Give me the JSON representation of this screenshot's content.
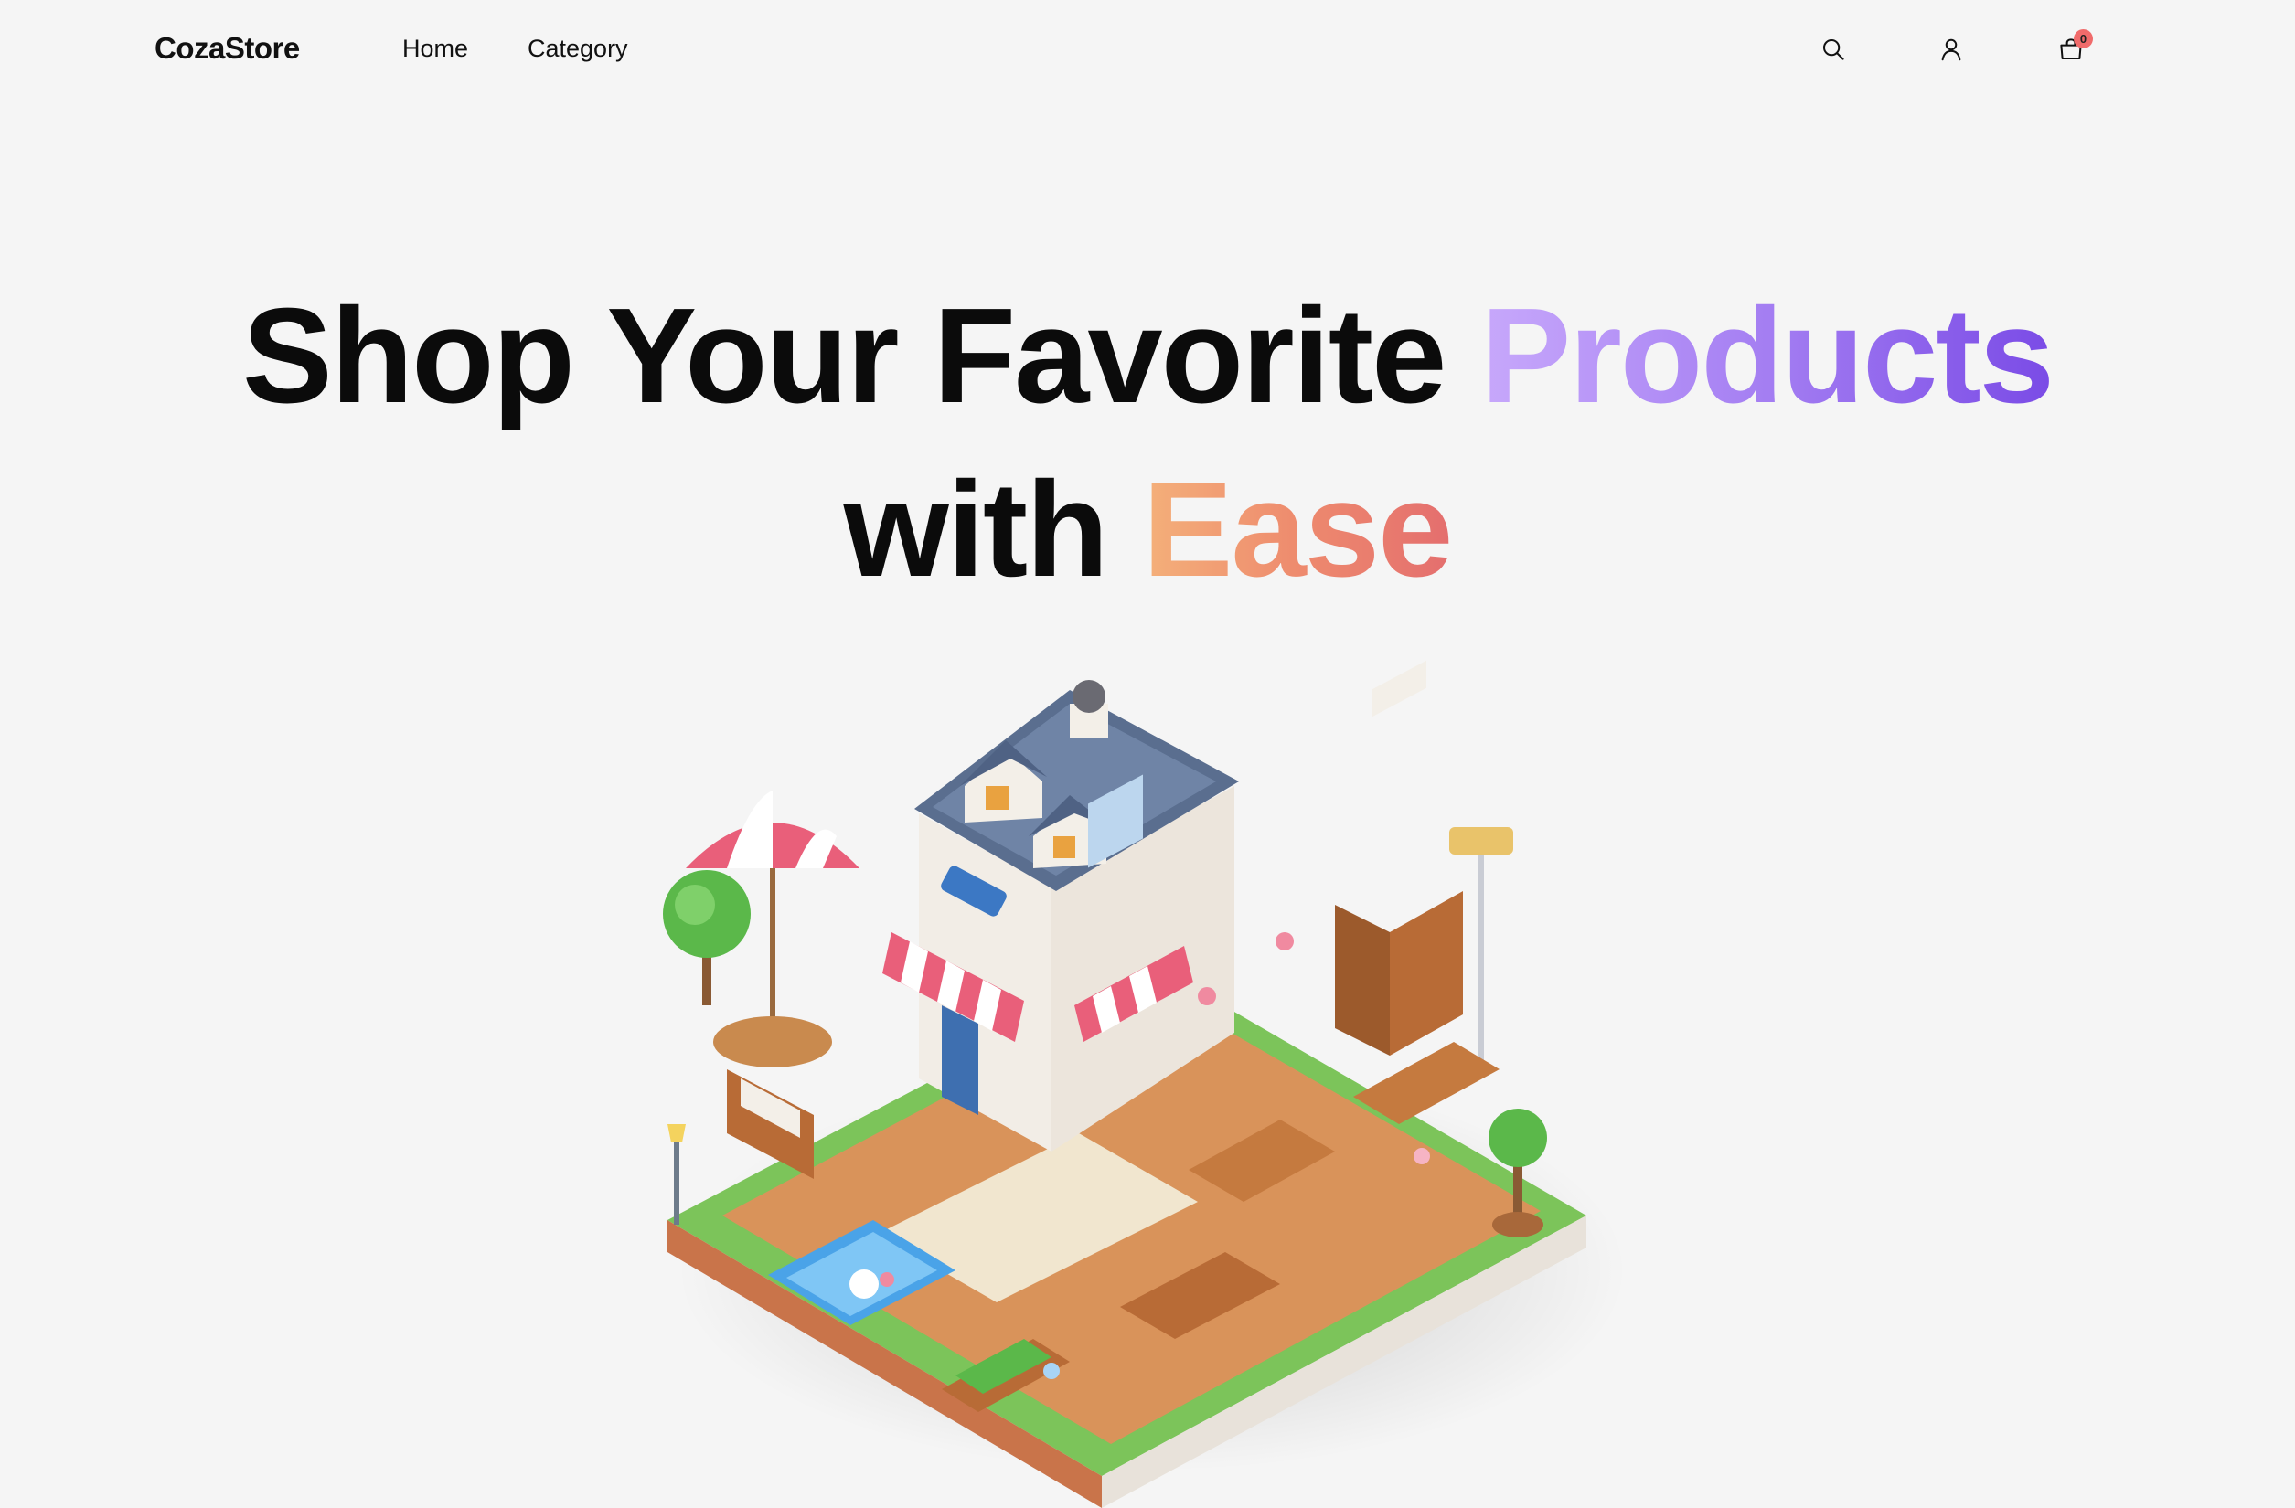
{
  "header": {
    "brand": "CozaStore",
    "nav": {
      "home": "Home",
      "category": "Category"
    },
    "icons": {
      "search": "search-icon",
      "user": "user-icon",
      "cart": "cart-icon"
    },
    "cart_count": "0",
    "badge_color": "#f06b6b"
  },
  "hero": {
    "line1_plain": "Shop Your Favorite",
    "line1_accent": "Products",
    "line2_plain": "with",
    "line2_accent": "Ease",
    "accent_purple": "#9a6cf0",
    "accent_orange": "#ee8b6e"
  }
}
